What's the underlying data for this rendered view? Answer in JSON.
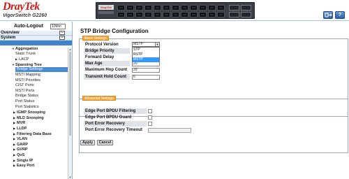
{
  "header": {
    "brand": "DrayTek",
    "model": "VigorSwitch G2260",
    "panel_logo": "DrayTek",
    "icons": [
      "logout-icon",
      "help-icon"
    ]
  },
  "sidebar": {
    "auto_logout_label": "Auto-Logout",
    "auto_logout_value": "10Min",
    "overview": "Overview",
    "system": "System",
    "configuration": "",
    "tree": [
      {
        "label": "Aggregation",
        "bold": true
      },
      {
        "label": "Static Trunk"
      },
      {
        "label": "LACP"
      },
      {
        "label": "Spanning Tree",
        "bold": true
      },
      {
        "label": "Bridge Settings",
        "active": true
      },
      {
        "label": "MSTI Mapping"
      },
      {
        "label": "MSTI Priorities"
      },
      {
        "label": "CIST Ports"
      },
      {
        "label": "MSTI Ports"
      },
      {
        "label": "Bridge Status"
      },
      {
        "label": "Port Status"
      },
      {
        "label": "Port Statistics"
      },
      {
        "label": "IGMP Snooping",
        "bold": true
      },
      {
        "label": "MLD Snooping",
        "bold": true
      },
      {
        "label": "MVR",
        "bold": true
      },
      {
        "label": "LLDP",
        "bold": true
      },
      {
        "label": "Filtering Data Base",
        "bold": true
      },
      {
        "label": "VLAN",
        "bold": true
      },
      {
        "label": "GARP",
        "bold": true
      },
      {
        "label": "GVRP",
        "bold": true
      },
      {
        "label": "QoS",
        "bold": true
      },
      {
        "label": "Single IP",
        "bold": true
      },
      {
        "label": "Easy Port",
        "bold": true
      }
    ]
  },
  "main": {
    "title": "STP Bridge Configuration",
    "basic_legend": "Basic Settings",
    "basic": {
      "protocol_version_label": "Protocol Version",
      "protocol_version_value": "MSTP",
      "protocol_options": [
        "STP",
        "RSTP",
        "MSTP"
      ],
      "bridge_priority_label": "Bridge Priority",
      "forward_delay_label": "Forward Delay",
      "max_age_label": "Max Age",
      "max_age_value": "20",
      "max_hop_label": "Maximum Hop Count",
      "max_hop_value": "20",
      "tx_hold_label": "Transmit Hold Count",
      "tx_hold_value": "6"
    },
    "advanced_legend": "Advanced Settings",
    "advanced": {
      "bpdu_filtering_label": "Edge Port BPDU Filtering",
      "bpdu_guard_label": "Edge Port BPDU Guard",
      "error_recovery_label": "Port Error Recovery",
      "error_timeout_label": "Port Error Recovery Timeout"
    },
    "apply_label": "Apply",
    "cancel_label": "Cancel"
  },
  "colors": {
    "brand_red": "#c8201e",
    "legend_orange": "#f4a63a",
    "nav_active": "#4a8cd0",
    "dropdown_selected": "#3399ff"
  }
}
